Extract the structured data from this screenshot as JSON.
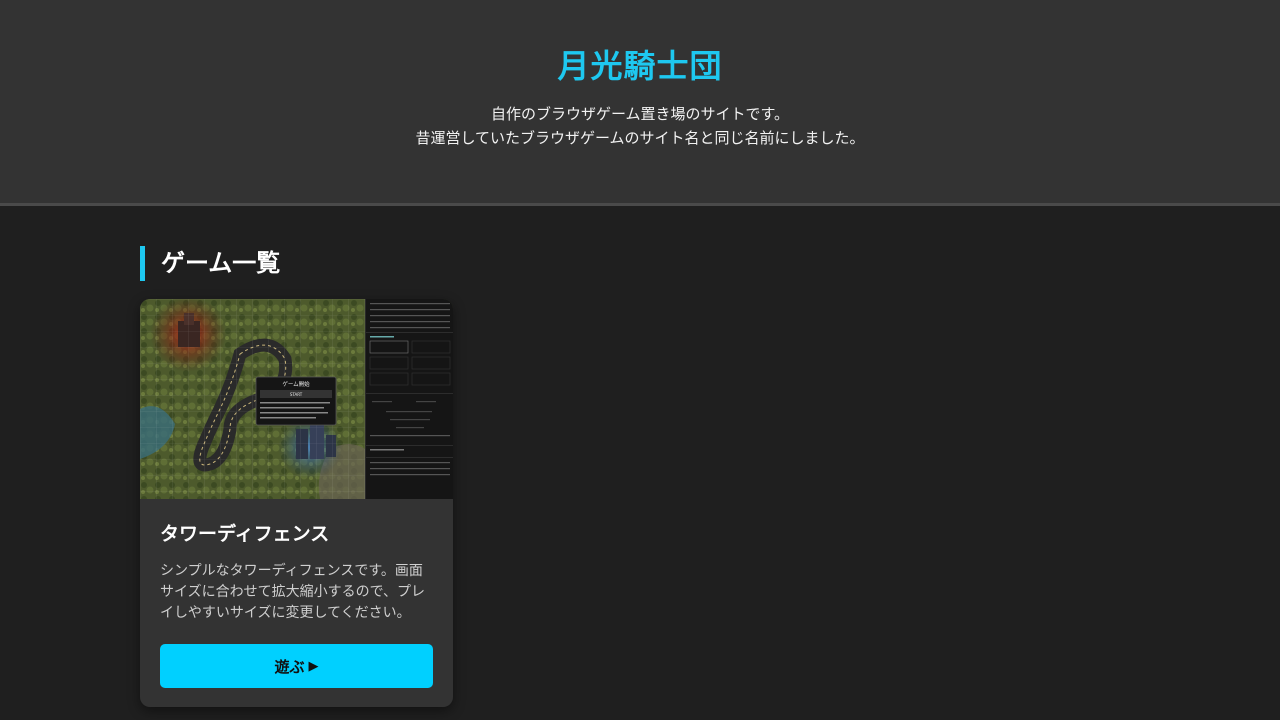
{
  "header": {
    "title": "月光騎士団",
    "description_line1": "自作のブラウザゲーム置き場のサイトです。",
    "description_line2": "昔運営していたブラウザゲームのサイト名と同じ名前にしました。"
  },
  "main": {
    "section_title": "ゲーム一覧",
    "games": [
      {
        "title": "タワーディフェンス",
        "description": "シンプルなタワーディフェンスです。画面サイズに合わせて拡大縮小するので、プレイしやすいサイズに変更してください。",
        "play_label": "遊ぶ",
        "play_icon": "▶",
        "thumbnail_overlay_title": "ゲーム開始",
        "thumbnail_overlay_button": "START"
      }
    ]
  },
  "colors": {
    "accent": "#1ec8f0",
    "button": "#00d0ff",
    "background": "#1f1f1f",
    "header_bg": "#333333",
    "card_bg": "#333333"
  }
}
